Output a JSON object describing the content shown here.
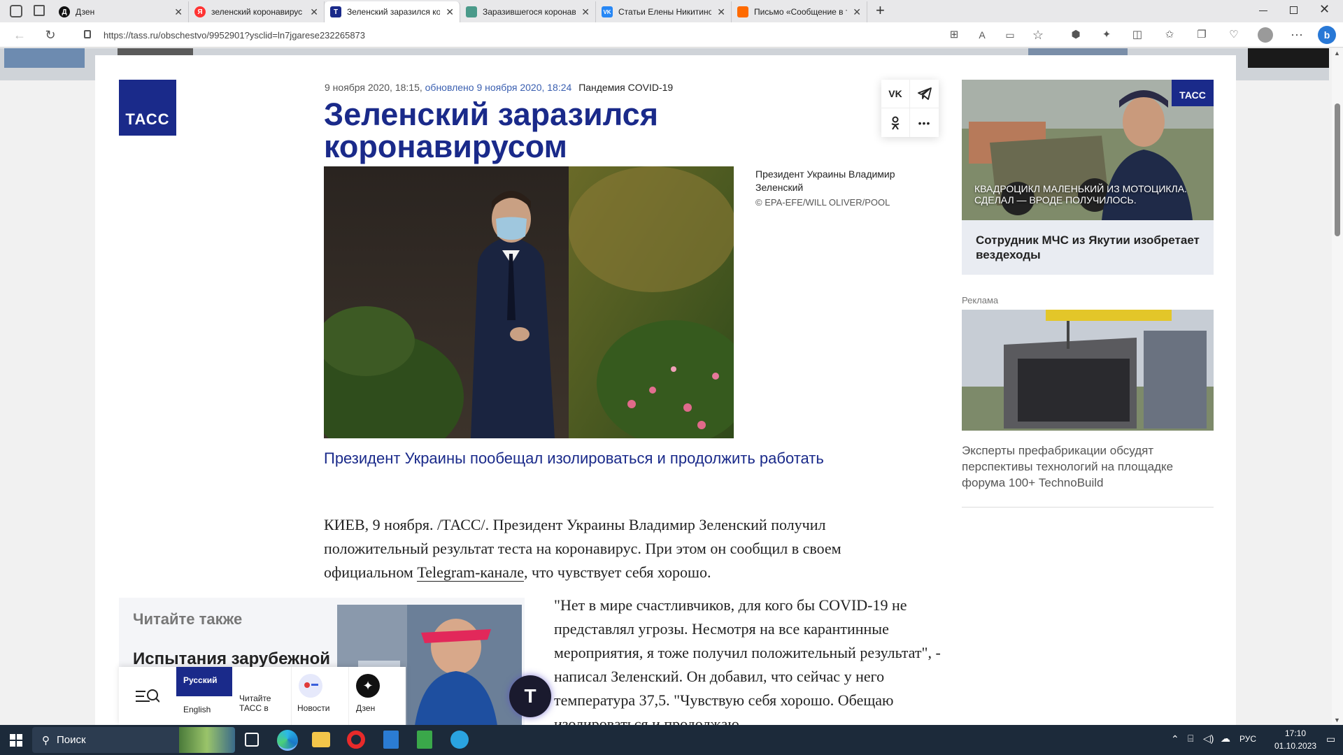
{
  "tabs": [
    {
      "title": "Дзен",
      "color": "#111111",
      "icon": "Д"
    },
    {
      "title": "зеленский коронавирус — Яндекс",
      "color": "#ff3333",
      "icon": "Я"
    },
    {
      "title": "Зеленский заразился коронавирусом",
      "color": "#1a2a8a",
      "icon": "T"
    },
    {
      "title": "Заразившегося коронавирусом",
      "color": "#4a9a8a",
      "icon": ""
    },
    {
      "title": "Статьи Елены Никитиной",
      "color": "#2787f5",
      "icon": "VK"
    },
    {
      "title": "Письмо «Сообщение в теме: З",
      "color": "#ff6a00",
      "icon": ""
    }
  ],
  "address": {
    "url": "https://tass.ru/obschestvo/9952901?ysclid=ln7jgarese232265873"
  },
  "logo": "ТАСС",
  "article": {
    "date": "9 ноября 2020, 18:15,",
    "updated": "обновлено 9 ноября 2020, 18:24",
    "rubric": "Пандемия COVID-19",
    "title": "Зеленский заразился коронавирусом",
    "caption": "Президент Украины Владимир Зеленский",
    "credit": "© EPA-EFE/WILL OLIVER/POOL",
    "lead": "Президент Украины пообещал изолироваться и продолжить работать",
    "p1_before": "КИЕВ, 9 ноября. /ТАСС/. Президент Украины Владимир Зеленский получил положительный результат теста на коронавирус. При этом он сообщил в своем официальном ",
    "p1_link": "Telegram-канале",
    "p1_after": ", что чувствует себя хорошо.",
    "p2": "\"Нет в мире счастливчиков, для кого бы COVID-19 не представлял угрозы. Несмотря на все карантинные мероприятия, я тоже получил положительный результат\", - написал Зеленский. Он добавил, что сейчас у него температура 37,5. \"Чувствую себя хорошо. Обещаю изолироваться и продолжаю"
  },
  "readalso": {
    "heading": "Читайте также",
    "title": "Испытания зарубежной"
  },
  "share": {
    "vk": "VK",
    "telegram": "Telegram",
    "ok": "OK",
    "more": "•••"
  },
  "sidebar": {
    "promo_overlay": "КВАДРОЦИКЛ МАЛЕНЬКИЙ ИЗ МОТОЦИКЛА. СДЕЛАЛ — ВРОДЕ ПОЛУЧИЛОСЬ.",
    "promo_badge": "ТАСС",
    "promo_title": "Сотрудник МЧС из Якутии изобретает вездеходы",
    "ad_label": "Реклама",
    "ad_title": "Эксперты префабрикации обсудят перспективы технологий на площадке форума 100+ TechnoBuild"
  },
  "bottombar": {
    "lang_ru": "Русский",
    "lang_en": "English",
    "read_in": "Читайте ТАСС в",
    "news": "Новости",
    "dzen": "Дзен"
  },
  "taskbar": {
    "search": "Поиск",
    "lang": "РУС",
    "time": "17:10",
    "date": "01.10.2023"
  }
}
